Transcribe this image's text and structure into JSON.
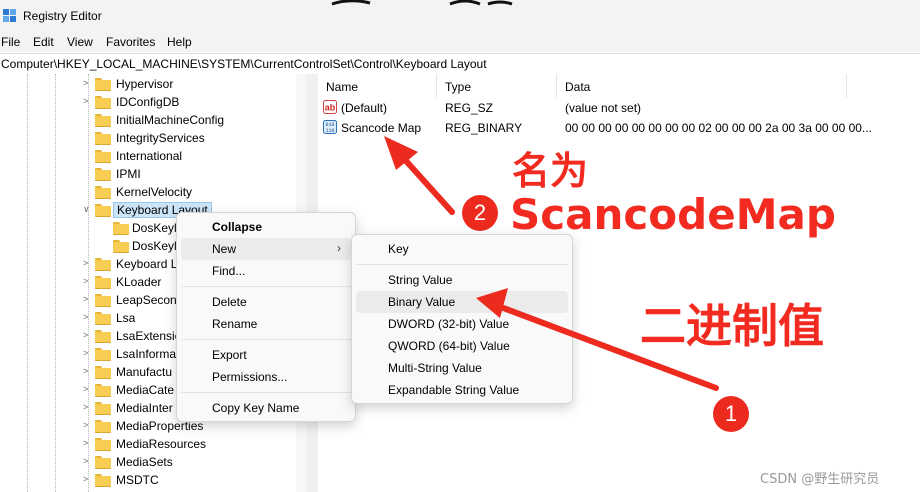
{
  "window": {
    "title": "Registry Editor"
  },
  "menu": [
    "File",
    "Edit",
    "View",
    "Favorites",
    "Help"
  ],
  "address": "Computer\\HKEY_LOCAL_MACHINE\\SYSTEM\\CurrentControlSet\\Control\\Keyboard Layout",
  "tree": {
    "items": [
      {
        "label": "Hypervisor"
      },
      {
        "label": "IDConfigDB"
      },
      {
        "label": "InitialMachineConfig"
      },
      {
        "label": "IntegrityServices"
      },
      {
        "label": "International"
      },
      {
        "label": "IPMI"
      },
      {
        "label": "KernelVelocity"
      },
      {
        "label": "Keyboard Layout"
      },
      {
        "label": "DosKeyl"
      },
      {
        "label": "DosKeyl"
      },
      {
        "label": "Keyboard L"
      },
      {
        "label": "KLoader"
      },
      {
        "label": "LeapSecon"
      },
      {
        "label": "Lsa"
      },
      {
        "label": "LsaExtensio"
      },
      {
        "label": "LsaInforma"
      },
      {
        "label": "Manufactu"
      },
      {
        "label": "MediaCate"
      },
      {
        "label": "MediaInter"
      },
      {
        "label": "MediaProperties"
      },
      {
        "label": "MediaResources"
      },
      {
        "label": "MediaSets"
      },
      {
        "label": "MSDTC"
      }
    ]
  },
  "list": {
    "columns": [
      "Name",
      "Type",
      "Data"
    ],
    "rows": [
      {
        "name": "(Default)",
        "type": "REG_SZ",
        "data": "(value not set)",
        "icon": "string-value-icon"
      },
      {
        "name": "Scancode Map",
        "type": "REG_BINARY",
        "data": "00 00 00 00 00 00 00 00 02 00 00 00 2a 00 3a 00 00 00...",
        "icon": "binary-value-icon"
      }
    ]
  },
  "context_menu": {
    "items": [
      "Collapse",
      "New",
      "Find...",
      "Delete",
      "Rename",
      "Export",
      "Permissions...",
      "Copy Key Name"
    ],
    "chevron": "›"
  },
  "submenu": {
    "items": [
      "Key",
      "String Value",
      "Binary Value",
      "DWORD (32-bit) Value",
      "QWORD (64-bit) Value",
      "Multi-String Value",
      "Expandable String Value"
    ]
  },
  "annotations": {
    "label_name_cn": "名为",
    "label_name_en": "ScancodeMap",
    "label_binary": "二进制值",
    "badge_1": "1",
    "badge_2": "2",
    "color": "#f22a1f"
  },
  "watermark": "CSDN @野生研究员"
}
